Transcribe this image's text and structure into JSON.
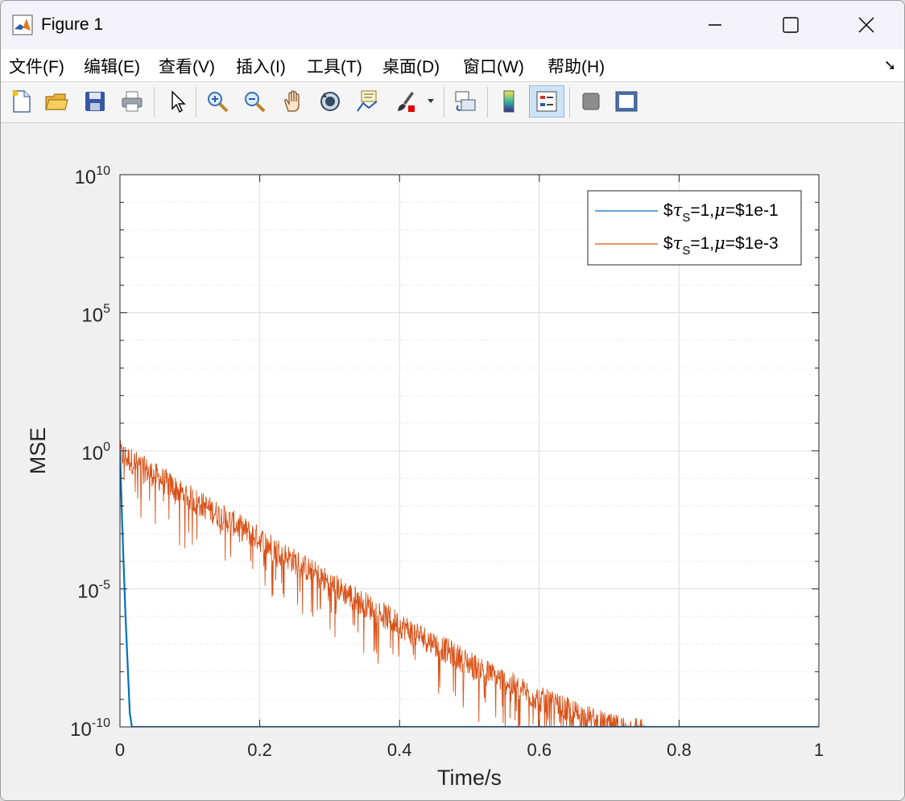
{
  "window": {
    "title": "Figure 1",
    "controls": [
      "minimize",
      "maximize",
      "close"
    ]
  },
  "menu": [
    {
      "label": "文件(F)"
    },
    {
      "label": "编辑(E)"
    },
    {
      "label": "查看(V)"
    },
    {
      "label": "插入(I)"
    },
    {
      "label": "工具(T)"
    },
    {
      "label": "桌面(D)"
    },
    {
      "label": "窗口(W)"
    },
    {
      "label": "帮助(H)"
    }
  ],
  "toolbar": {
    "icons": [
      "new-figure-icon",
      "open-file-icon",
      "save-icon",
      "print-icon",
      "edit-plot-icon",
      "zoom-in-icon",
      "zoom-out-icon",
      "pan-icon",
      "rotate-3d-icon",
      "data-cursor-icon",
      "brush-icon",
      "link-plot-icon",
      "colorbar-icon",
      "legend-icon",
      "hide-plot-tools-icon",
      "show-plot-tools-icon"
    ],
    "active": "legend-icon"
  },
  "chart_data": {
    "type": "line",
    "title": "",
    "xlabel": "Time/s",
    "ylabel": "MSE",
    "xlim": [
      0,
      1
    ],
    "ylim_log10": [
      -10,
      10
    ],
    "yscale": "log",
    "grid": true,
    "minor_grid_y": true,
    "legend_position": "top-right",
    "x_ticks": [
      "0",
      "0.2",
      "0.4",
      "0.6",
      "0.8",
      "1"
    ],
    "y_ticks": [
      {
        "base": "10",
        "exp": "10"
      },
      {
        "base": "10",
        "exp": "5"
      },
      {
        "base": "10",
        "exp": "0"
      },
      {
        "base": "10",
        "exp": "-5"
      },
      {
        "base": "10",
        "exp": "-10"
      }
    ],
    "series": [
      {
        "name": "$τS=1,μ=$1e-1",
        "legend": {
          "prefix": "$",
          "tau": "τ",
          "sub": "S",
          "mid": "=1,",
          "mu": "μ",
          "suffix": "=$1e-1"
        },
        "color": "#0072BD",
        "points_log10": [
          [
            0,
            0
          ],
          [
            0.003,
            -2.5
          ],
          [
            0.008,
            -6
          ],
          [
            0.014,
            -9.5
          ],
          [
            0.017,
            -10
          ],
          [
            1,
            -10
          ]
        ]
      },
      {
        "name": "$τS=1,μ=$1e-3",
        "legend": {
          "prefix": "$",
          "tau": "τ",
          "sub": "S",
          "mid": "=1,",
          "mu": "μ",
          "suffix": "=$1e-3"
        },
        "color": "#D95319",
        "trend_log10": [
          [
            0,
            0
          ],
          [
            0.1,
            -1.6
          ],
          [
            0.2,
            -3.1
          ],
          [
            0.3,
            -4.7
          ],
          [
            0.4,
            -6.2
          ],
          [
            0.5,
            -7.6
          ],
          [
            0.6,
            -8.9
          ],
          [
            0.7,
            -9.9
          ],
          [
            0.75,
            -10
          ],
          [
            1,
            -10
          ]
        ],
        "noise_band_decades": 1.6
      }
    ]
  }
}
